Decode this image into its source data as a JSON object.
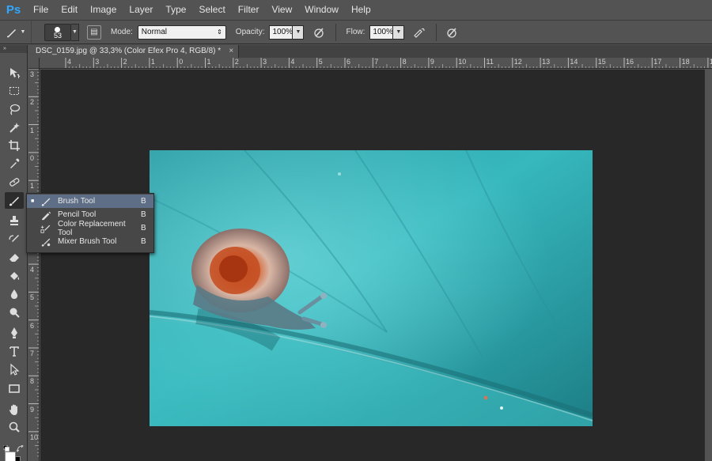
{
  "app": {
    "logo": "Ps"
  },
  "menu": [
    "File",
    "Edit",
    "Image",
    "Layer",
    "Type",
    "Select",
    "Filter",
    "View",
    "Window",
    "Help"
  ],
  "options_bar": {
    "brush_size": "53",
    "mode_label": "Mode:",
    "mode_value": "Normal",
    "opacity_label": "Opacity:",
    "opacity_value": "100%",
    "flow_label": "Flow:",
    "flow_value": "100%"
  },
  "toolbar_header": "»",
  "document_tab": {
    "title": "DSC_0159.jpg @ 33,3% (Color Efex Pro 4, RGB/8) *",
    "close": "×"
  },
  "ruler_h": [
    "4",
    "3",
    "2",
    "1",
    "0",
    "1",
    "2",
    "3",
    "4",
    "5",
    "6",
    "7",
    "8",
    "9",
    "10",
    "11",
    "12",
    "13",
    "14",
    "15",
    "16",
    "17",
    "18",
    "19",
    "20",
    "21",
    "22"
  ],
  "ruler_v": [
    "3",
    "2",
    "1",
    "0",
    "1",
    "2",
    "3",
    "4",
    "5",
    "6",
    "7",
    "8",
    "9",
    "10"
  ],
  "flyout": {
    "items": [
      {
        "label": "Brush Tool",
        "shortcut": "B",
        "selected": true,
        "check": "■"
      },
      {
        "label": "Pencil Tool",
        "shortcut": "B",
        "selected": false
      },
      {
        "label": "Color Replacement Tool",
        "shortcut": "B",
        "selected": false
      },
      {
        "label": "Mixer Brush Tool",
        "shortcut": "B",
        "selected": false
      }
    ]
  },
  "tools": [
    "move-tool-icon",
    "marquee-tool-icon",
    "lasso-tool-icon",
    "magic-wand-icon",
    "crop-tool-icon",
    "eyedropper-icon",
    "healing-brush-icon",
    "brush-tool-icon",
    "clone-stamp-icon",
    "history-brush-icon",
    "eraser-icon",
    "paint-bucket-icon",
    "blur-tool-icon",
    "dodge-tool-icon",
    "pen-tool-icon",
    "type-tool-icon",
    "path-selection-icon",
    "rectangle-tool-icon",
    "hand-tool-icon",
    "zoom-tool-icon"
  ],
  "colors": {
    "panel": "#535353",
    "canvas": "#282828",
    "highlight": "#5e6e86",
    "ps_blue": "#31a8ff"
  }
}
